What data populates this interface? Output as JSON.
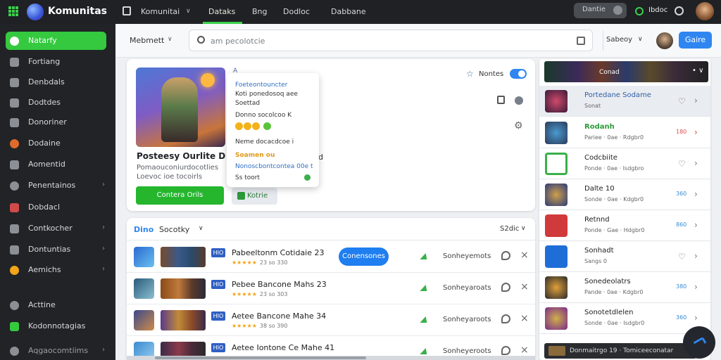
{
  "app": {
    "name": "Komunitas"
  },
  "topnav": {
    "tabs": [
      {
        "label": "Komunitai"
      },
      {
        "label": "Dataks"
      },
      {
        "label": "Bng"
      },
      {
        "label": "Dodloc"
      },
      {
        "label": "Dabbane"
      }
    ],
    "search_label": "Dantie",
    "user_label": "Ibdoc",
    "accent_color": "#3ad14b"
  },
  "sidebar": {
    "items": [
      {
        "label": "Natarfy",
        "icon": "whatsapp-icon",
        "active": true
      },
      {
        "label": "Fortiang",
        "icon": "user-icon"
      },
      {
        "label": "Denbdals",
        "icon": "controller-icon"
      },
      {
        "label": "Dodtdes",
        "icon": "monitor-icon"
      },
      {
        "label": "Donoriner",
        "icon": "puzzle-icon"
      },
      {
        "label": "Dodaine",
        "icon": "palette-icon"
      },
      {
        "label": "Aomentid",
        "icon": "folder-icon"
      },
      {
        "label": "Penentainos",
        "icon": "globe-icon",
        "arrow": "›"
      },
      {
        "label": "Dobdacl",
        "icon": "gamepad-icon"
      },
      {
        "label": "Contkocher",
        "icon": "pin-icon",
        "arrow": "›"
      },
      {
        "label": "Dontuntias",
        "icon": "chip-icon",
        "arrow": "›"
      },
      {
        "label": "Aemichs",
        "icon": "smile-icon",
        "arrow": "›"
      },
      {
        "label": "Acttine",
        "icon": "settings-icon"
      },
      {
        "label": "Kodonnotagias",
        "icon": "chat-icon"
      },
      {
        "label": "Aqgaocomtiims",
        "icon": "info-icon",
        "arrow": "›"
      }
    ]
  },
  "subheader": {
    "crumb": "Mebmett",
    "search_placeholder": "am pecolotcie",
    "sort_label": "Sabeoy",
    "primary_label": "Gaire"
  },
  "hero": {
    "title": "Posteesy Ourlite",
    "title_suffix": "D",
    "subtitle1": "Pomaouconiurdocotlies",
    "subtitle2": "Loevoc ioe tocoirls",
    "meta": "A",
    "cut_text": "d",
    "cta_label": "Contera Orils",
    "secondary_label": "Kotrie",
    "toggle_label": "Nontes",
    "toggle_on": true
  },
  "popover": {
    "title": "Foeteontouncter",
    "line2": "Koti ponedosoq aee",
    "line3": "Soettad",
    "line4": "Donno socolcoo",
    "line4_suffix": "K",
    "line5": "Neme docacdcoe",
    "line5_suffix": "i",
    "line6": "Soamen",
    "line6_suffix": "ou",
    "line7": "Nonoscbontcontea 00e",
    "line7_suffix": "t",
    "line8": "Ss toort"
  },
  "list": {
    "head_blue": "Dino",
    "head_label": "Socotky",
    "head_right": "S2dic",
    "tag_text": "HIO",
    "rows": [
      {
        "name": "Pabeeltonm Cotidaie 23",
        "rating": "★★★★★",
        "rating_count": "23 so 330",
        "action": "Conensones",
        "meta": "Sonheyemots"
      },
      {
        "name": "Pebee Bancone Mahs 23",
        "rating": "★★★★★",
        "rating_count": "23 so 303",
        "meta": "Sonheyaroats"
      },
      {
        "name": "Aetee Bancone Mahe 34",
        "rating": "★★★★★",
        "rating_count": "38 so 390",
        "meta": "Sonheyaroots"
      },
      {
        "name": "Aetee Iontone Ce Mahe 41",
        "rating": "★★★★★",
        "rating_count": "",
        "meta": "Sonheyeroots"
      }
    ]
  },
  "right_panel": {
    "banner_label": "Conad",
    "banner_controls": "• ∨",
    "rows": [
      {
        "name": "Portedane Sodame",
        "sub": "Sonat",
        "style": "blue",
        "selected": true
      },
      {
        "name": "Rodanh",
        "sub": "Pariee · 0ae · Rdgbr0",
        "style": "green",
        "value": "180",
        "value_style": "red"
      },
      {
        "name": "Codcbiite",
        "sub": "Ponde · 0ae · Isdgbro",
        "style": "normal"
      },
      {
        "name": "Dalte 10",
        "sub": "Sonde · 0ae · Kdgbr0",
        "style": "normal",
        "value": "360"
      },
      {
        "name": "Retnnd",
        "sub": "Ponde · Gae · Hdgbr0",
        "style": "normal",
        "value": "860"
      },
      {
        "name": "Sonhadt",
        "sub": "Sangs 0",
        "style": "normal"
      },
      {
        "name": "Sonedeolatrs",
        "sub": "Pande · 0ae · Kdgbr0",
        "style": "normal",
        "value": "380"
      },
      {
        "name": "Sonotetdlelen",
        "sub": "Sonde · 0ae · Isdgbr0",
        "style": "normal",
        "value": "360"
      }
    ],
    "footer": "Donmaitrgo 19 · Tomiceeconatar"
  },
  "colors": {
    "sidebar_bg": "#212326",
    "active_green": "#35c93f",
    "primary_blue": "#2f86f0",
    "cta_green": "#25b62e"
  }
}
